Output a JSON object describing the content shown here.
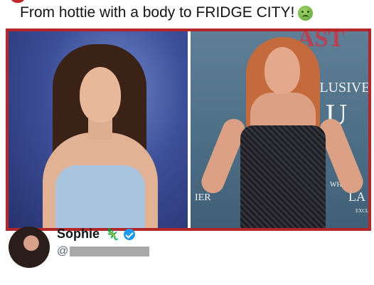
{
  "tweet": {
    "text": "From hottie with a body to FRIDGE CITY!",
    "emoji": "nauseated-face"
  },
  "media": {
    "right_photo_backdrop_text": [
      "AST",
      "CLUSIVE",
      "U",
      "IER",
      "WHAT YO",
      "LA",
      "EXCLU"
    ]
  },
  "author": {
    "name": "Sophie",
    "name_emoji": "lizard",
    "verified": true,
    "handle_prefix": "@"
  },
  "colors": {
    "frame_border": "#b5262b",
    "verified_badge": "#1d9bf0",
    "handle_text": "#536471"
  }
}
